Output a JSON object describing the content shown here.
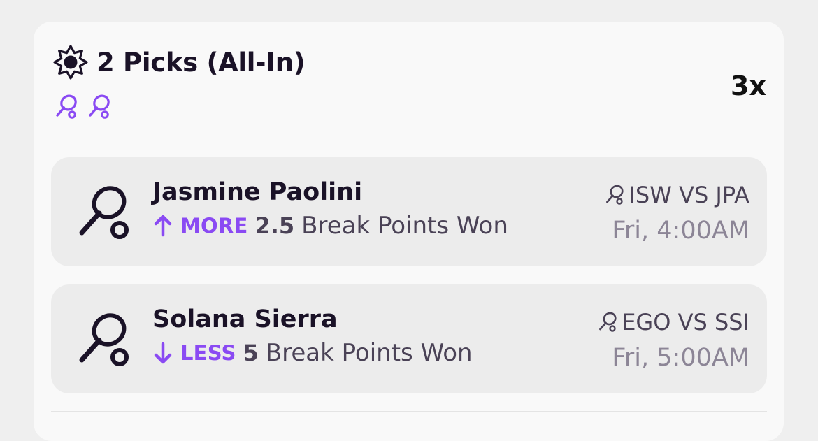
{
  "header": {
    "icon": "sun-icon",
    "title": "2 Picks (All-In)",
    "sport_icons": [
      "tennis-racket-icon",
      "tennis-racket-icon"
    ],
    "multiplier": "3x"
  },
  "colors": {
    "accent": "#8a4af3",
    "text_dark": "#1a1227",
    "text_muted": "#4a4256",
    "text_light": "#8c8596",
    "card_bg": "#f9f9f9",
    "pick_bg": "#ececec"
  },
  "picks": [
    {
      "player": "Jasmine Paolini",
      "direction": "MORE",
      "direction_icon": "arrow-up-icon",
      "line": "2.5",
      "stat": "Break Points Won",
      "matchup": "ISW VS JPA",
      "time": "Fri, 4:00AM"
    },
    {
      "player": "Solana Sierra",
      "direction": "LESS",
      "direction_icon": "arrow-down-icon",
      "line": "5",
      "stat": "Break Points Won",
      "matchup": "EGO VS SSI",
      "time": "Fri, 5:00AM"
    }
  ]
}
